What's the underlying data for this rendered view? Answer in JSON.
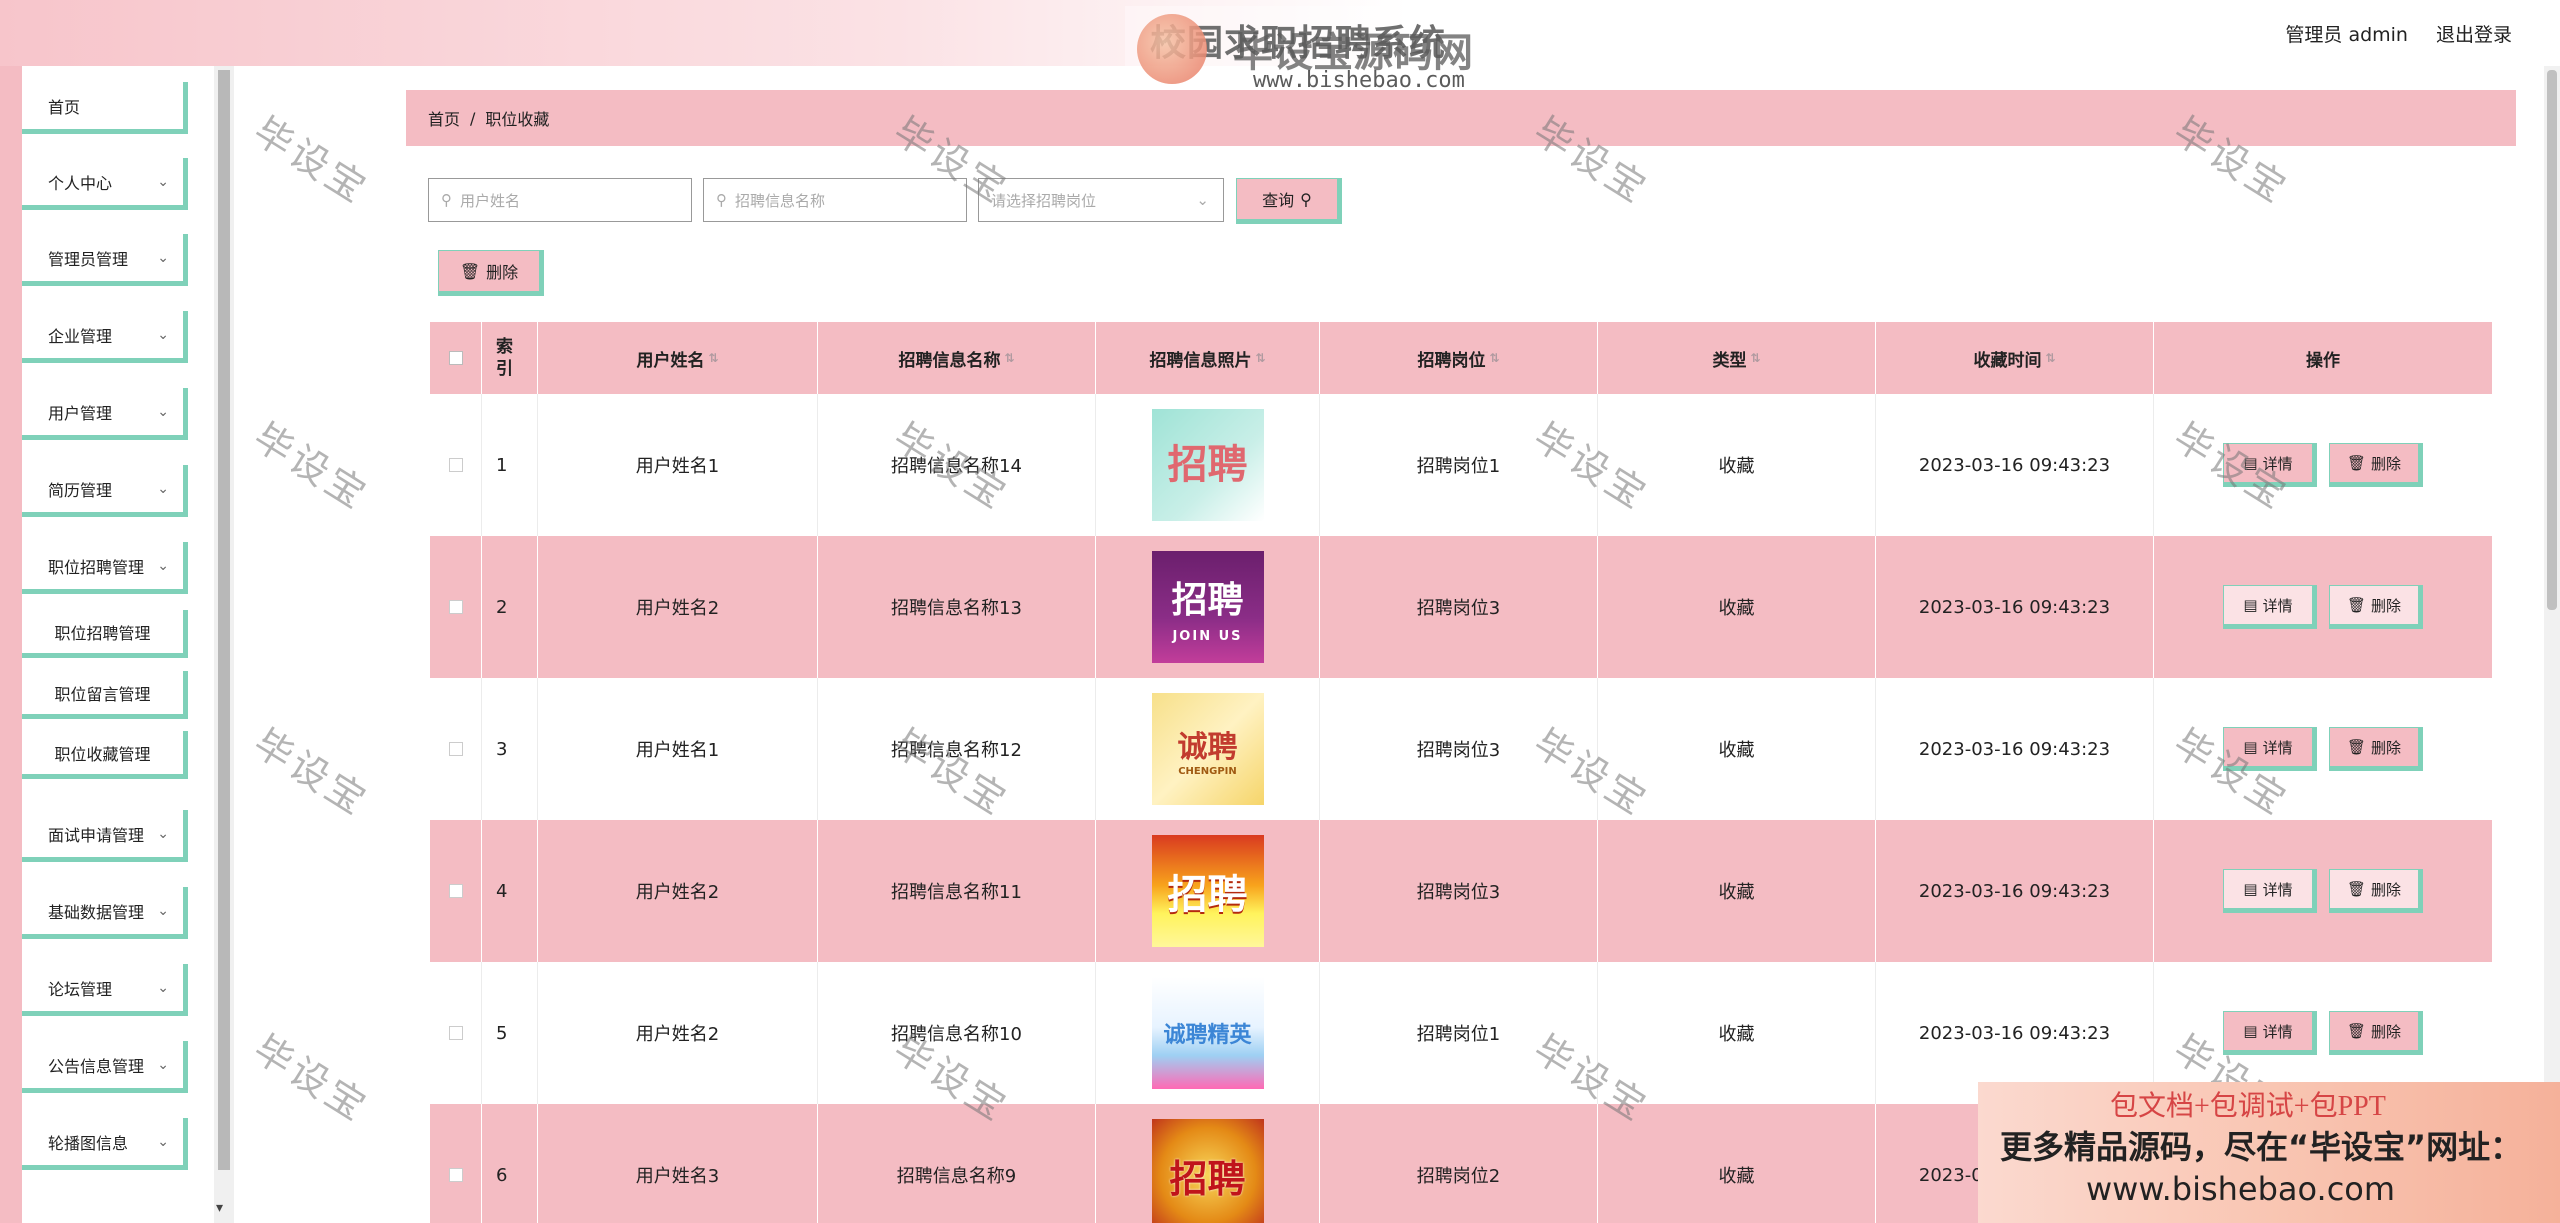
{
  "header": {
    "title": "校园求职招聘系统",
    "user_label": "管理员 admin",
    "logout_label": "退出登录"
  },
  "watermark_logo": {
    "name": "毕设宝源码网",
    "url": "www.bishebao.com"
  },
  "sidebar": {
    "items": [
      {
        "label": "首页"
      },
      {
        "label": "个人中心"
      },
      {
        "label": "管理员管理"
      },
      {
        "label": "企业管理"
      },
      {
        "label": "用户管理"
      },
      {
        "label": "简历管理"
      },
      {
        "label": "职位招聘管理"
      },
      {
        "label": "面试申请管理"
      },
      {
        "label": "基础数据管理"
      },
      {
        "label": "论坛管理"
      },
      {
        "label": "公告信息管理"
      },
      {
        "label": "轮播图信息"
      }
    ],
    "subitems": [
      {
        "label": "职位招聘管理"
      },
      {
        "label": "职位留言管理"
      },
      {
        "label": "职位收藏管理"
      }
    ]
  },
  "breadcrumb": {
    "home": "首页",
    "separator": "/",
    "current": "职位收藏"
  },
  "search": {
    "user_name_placeholder": "用户姓名",
    "recruit_name_placeholder": "招聘信息名称",
    "position_placeholder": "请选择招聘岗位",
    "query_label": "查询"
  },
  "toolbar": {
    "delete_label": "删除"
  },
  "table": {
    "headers": {
      "index": "索引",
      "user_name": "用户姓名",
      "recruit_name": "招聘信息名称",
      "recruit_photo": "招聘信息照片",
      "position": "招聘岗位",
      "type": "类型",
      "collect_time": "收藏时间",
      "ops": "操作"
    },
    "detail_label": "详情",
    "delete_label": "删除",
    "rows": [
      {
        "index": "1",
        "user_name": "用户姓名1",
        "recruit_name": "招聘信息名称14",
        "position": "招聘岗位1",
        "type": "收藏",
        "time": "2023-03-16 09:43:23"
      },
      {
        "index": "2",
        "user_name": "用户姓名2",
        "recruit_name": "招聘信息名称13",
        "position": "招聘岗位3",
        "type": "收藏",
        "time": "2023-03-16 09:43:23"
      },
      {
        "index": "3",
        "user_name": "用户姓名1",
        "recruit_name": "招聘信息名称12",
        "position": "招聘岗位3",
        "type": "收藏",
        "time": "2023-03-16 09:43:23"
      },
      {
        "index": "4",
        "user_name": "用户姓名2",
        "recruit_name": "招聘信息名称11",
        "position": "招聘岗位3",
        "type": "收藏",
        "time": "2023-03-16 09:43:23"
      },
      {
        "index": "5",
        "user_name": "用户姓名2",
        "recruit_name": "招聘信息名称10",
        "position": "招聘岗位1",
        "type": "收藏",
        "time": "2023-03-16 09:43:23"
      },
      {
        "index": "6",
        "user_name": "用户姓名3",
        "recruit_name": "招聘信息名称9",
        "position": "招聘岗位2",
        "type": "收藏",
        "time": "2023-03-16 09:43:23"
      }
    ],
    "posters": [
      {
        "big": "招聘"
      },
      {
        "big": "招聘",
        "small": "JOIN US"
      },
      {
        "big": "诚聘",
        "small": "CHENGPIN"
      },
      {
        "big": "招聘"
      },
      {
        "big": "诚聘精英"
      },
      {
        "big": "招聘"
      }
    ]
  },
  "watermark_text": "毕设宝",
  "ad_banner": {
    "line1": "包文档+包调试+包PPT",
    "line2": "更多精品源码，尽在“毕设宝”网址：",
    "line3": "www.bishebao.com"
  }
}
